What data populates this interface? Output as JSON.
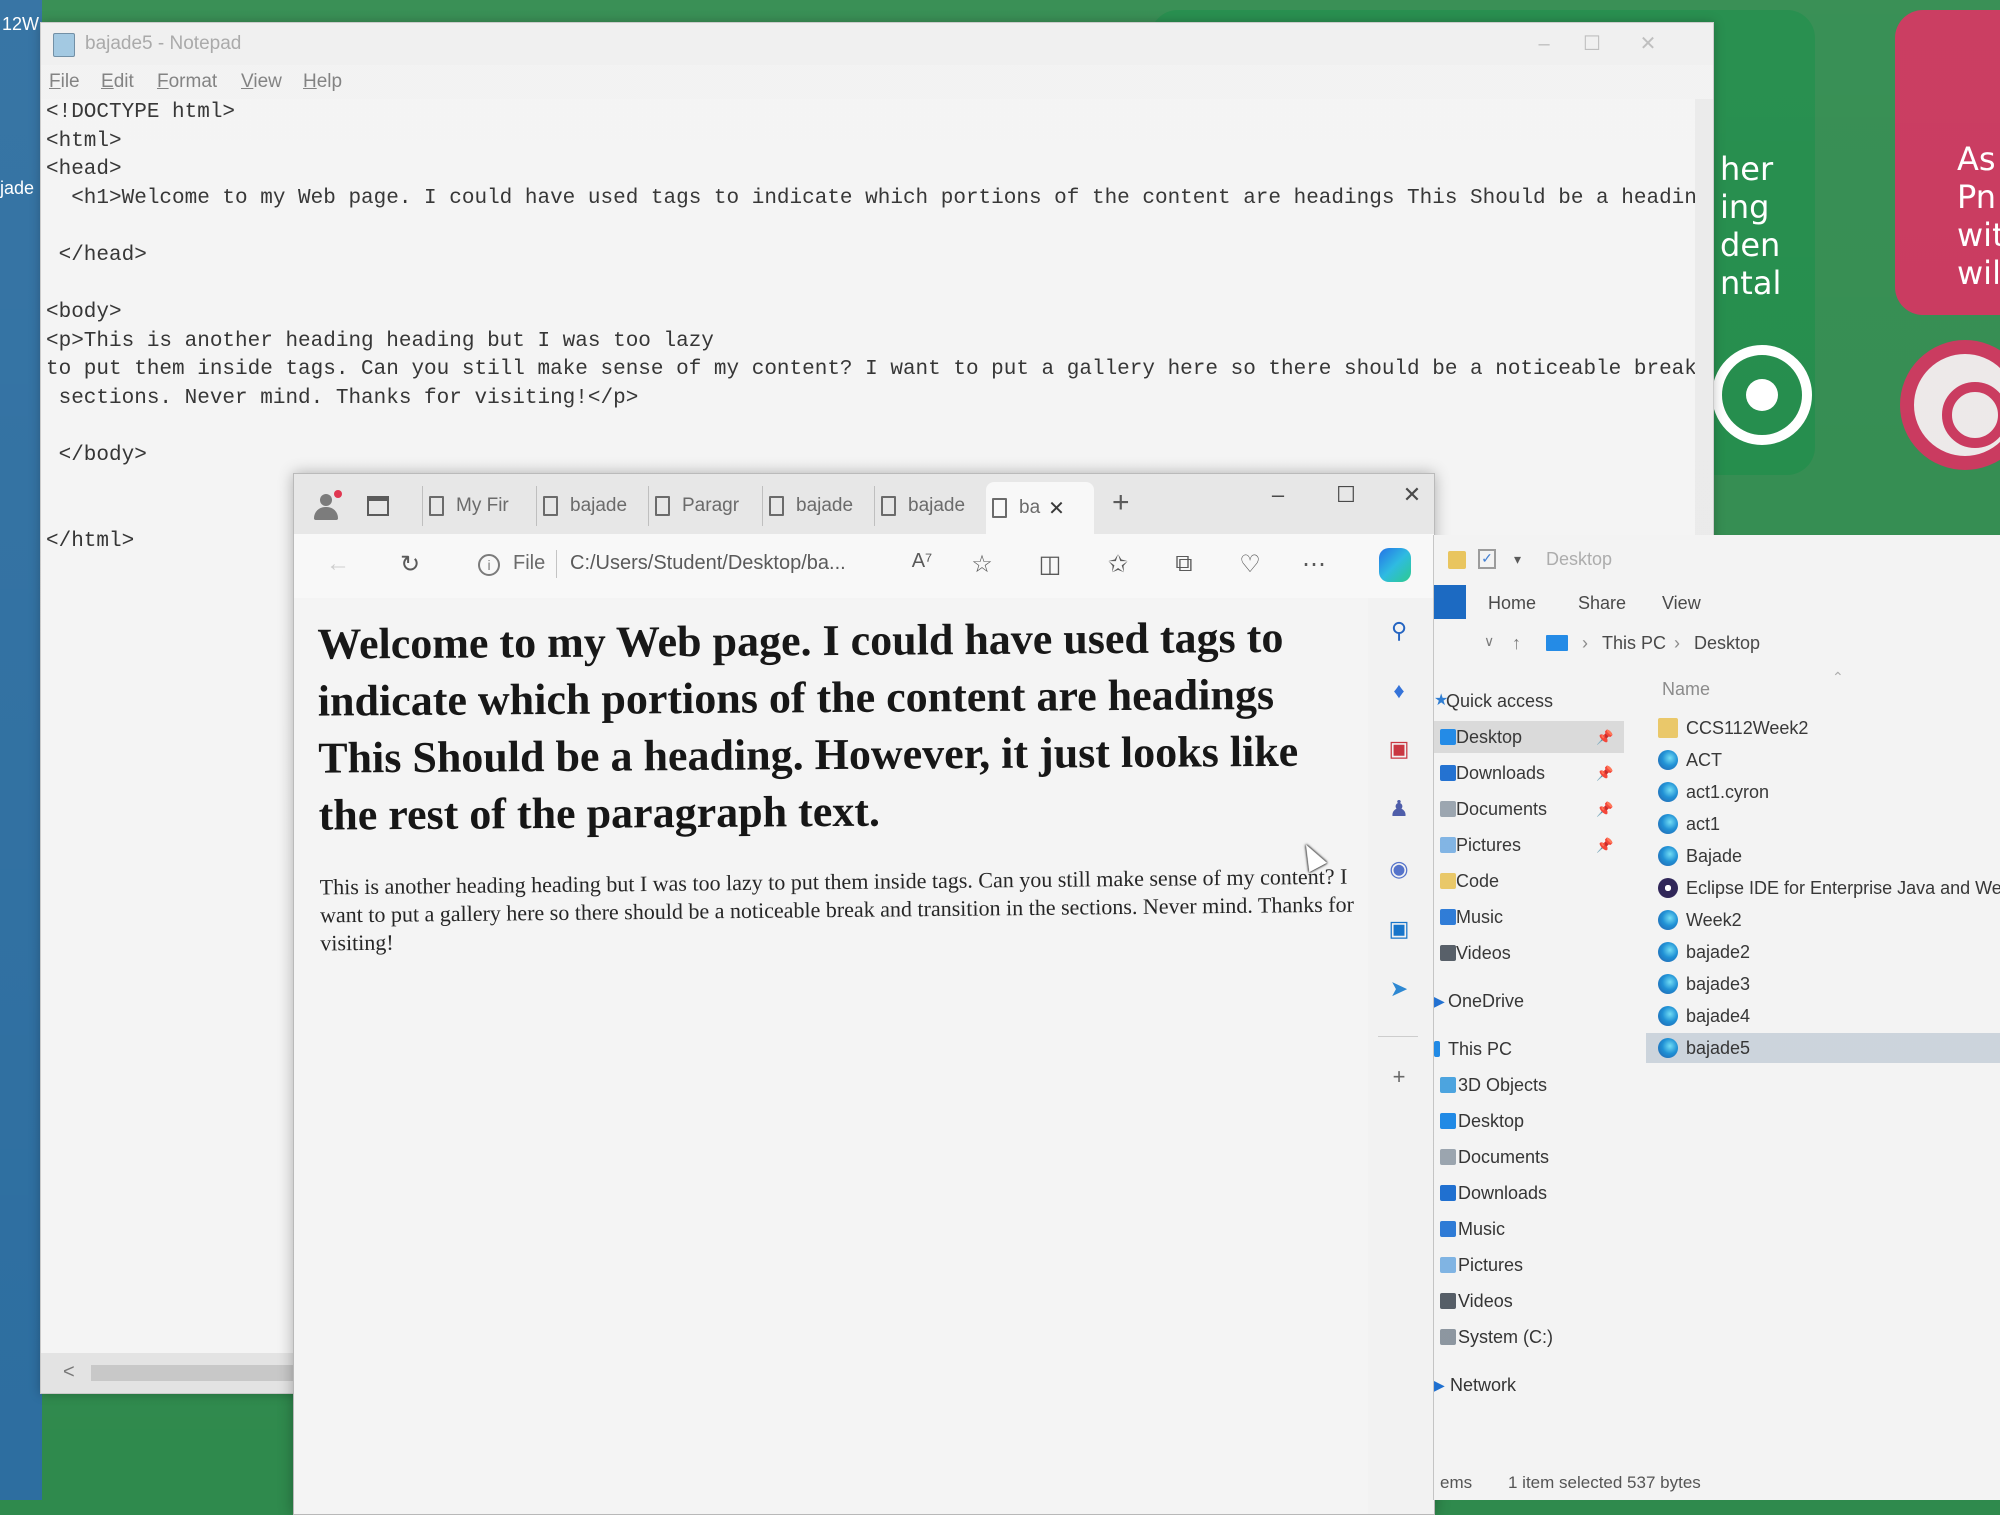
{
  "desktop": {
    "left_label_top": "12W",
    "left_label_mid": "jade",
    "green_card_text": [
      "her",
      "ing",
      "den",
      "ntal"
    ],
    "red_card_text": [
      "As",
      "Pn",
      "wit",
      "will"
    ]
  },
  "notepad": {
    "title": "bajade5 - Notepad",
    "menu": [
      "File",
      "Edit",
      "Format",
      "View",
      "Help"
    ],
    "content": "<!DOCTYPE html>\n<html>\n<head>\n  <h1>Welcome to my Web page. I could have used tags to indicate which portions of the content are headings This Should be a heading\n\n </head>\n\n<body>\n<p>This is another heading heading but I was too lazy\nto put them inside tags. Can you still make sense of my content? I want to put a gallery here so there should be a noticeable break\n sections. Never mind. Thanks for visiting!</p>\n\n </body>\n\n\n</html>",
    "hscroll_arrow": "<"
  },
  "browser": {
    "tabs": [
      {
        "label": "My Fir",
        "active": false
      },
      {
        "label": "bajade",
        "active": false
      },
      {
        "label": "Paragr",
        "active": false
      },
      {
        "label": "bajade",
        "active": false
      },
      {
        "label": "bajade",
        "active": false
      },
      {
        "label": "ba",
        "active": true
      }
    ],
    "new_tab_glyph": "+",
    "address_scheme": "File",
    "address_url": "C:/Users/Student/Desktop/ba...",
    "page": {
      "h1": "Welcome to my Web page. I could have used tags to indicate which portions of the content are headings This Should be a heading. However, it just looks like the rest of the paragraph text.",
      "p": "This is another heading heading but I was too lazy to put them inside tags. Can you still make sense of my content? I want to put a gallery here so there should be a noticeable break and transition in the sections. Never mind. Thanks for visiting!"
    }
  },
  "explorer": {
    "title": "Desktop",
    "ribbon_tabs": [
      "Home",
      "Share",
      "View"
    ],
    "breadcrumb": [
      "This PC",
      "Desktop"
    ],
    "column_name": "Name",
    "quick_access": "Quick access",
    "nav_items": [
      {
        "label": "Desktop",
        "pinned": true,
        "selected": true,
        "color": "#1e88e5"
      },
      {
        "label": "Downloads",
        "pinned": true,
        "color": "#1e6fd0"
      },
      {
        "label": "Documents",
        "pinned": true,
        "color": "#9aa4ae"
      },
      {
        "label": "Pictures",
        "pinned": true,
        "color": "#7fb3e3"
      },
      {
        "label": "Code",
        "pinned": false,
        "color": "#e9c766"
      },
      {
        "label": "Music",
        "pinned": false,
        "color": "#2c7ad6"
      },
      {
        "label": "Videos",
        "pinned": false,
        "color": "#555d66"
      }
    ],
    "onedrive": "OneDrive",
    "this_pc": "This PC",
    "pc_items": [
      {
        "label": "3D Objects",
        "color": "#4aa3df"
      },
      {
        "label": "Desktop",
        "color": "#1e88e5"
      },
      {
        "label": "Documents",
        "color": "#9aa4ae"
      },
      {
        "label": "Downloads",
        "color": "#1e6fd0"
      },
      {
        "label": "Music",
        "color": "#2c7ad6"
      },
      {
        "label": "Pictures",
        "color": "#7fb3e3"
      },
      {
        "label": "Videos",
        "color": "#555d66"
      },
      {
        "label": "System (C:)",
        "color": "#8c96a0"
      }
    ],
    "network": "Network",
    "files": [
      {
        "label": "CCS112Week2",
        "type": "folder"
      },
      {
        "label": "ACT",
        "type": "edge"
      },
      {
        "label": "act1.cyron",
        "type": "edge"
      },
      {
        "label": "act1",
        "type": "edge"
      },
      {
        "label": "Bajade",
        "type": "edge"
      },
      {
        "label": "Eclipse IDE for Enterprise Java and Web D...",
        "type": "eclipse"
      },
      {
        "label": "Week2",
        "type": "edge"
      },
      {
        "label": "bajade2",
        "type": "edge"
      },
      {
        "label": "bajade3",
        "type": "edge"
      },
      {
        "label": "bajade4",
        "type": "edge"
      },
      {
        "label": "bajade5",
        "type": "edge",
        "selected": true
      }
    ],
    "status_items": "ems",
    "status_selected": "1 item selected  537 bytes"
  }
}
